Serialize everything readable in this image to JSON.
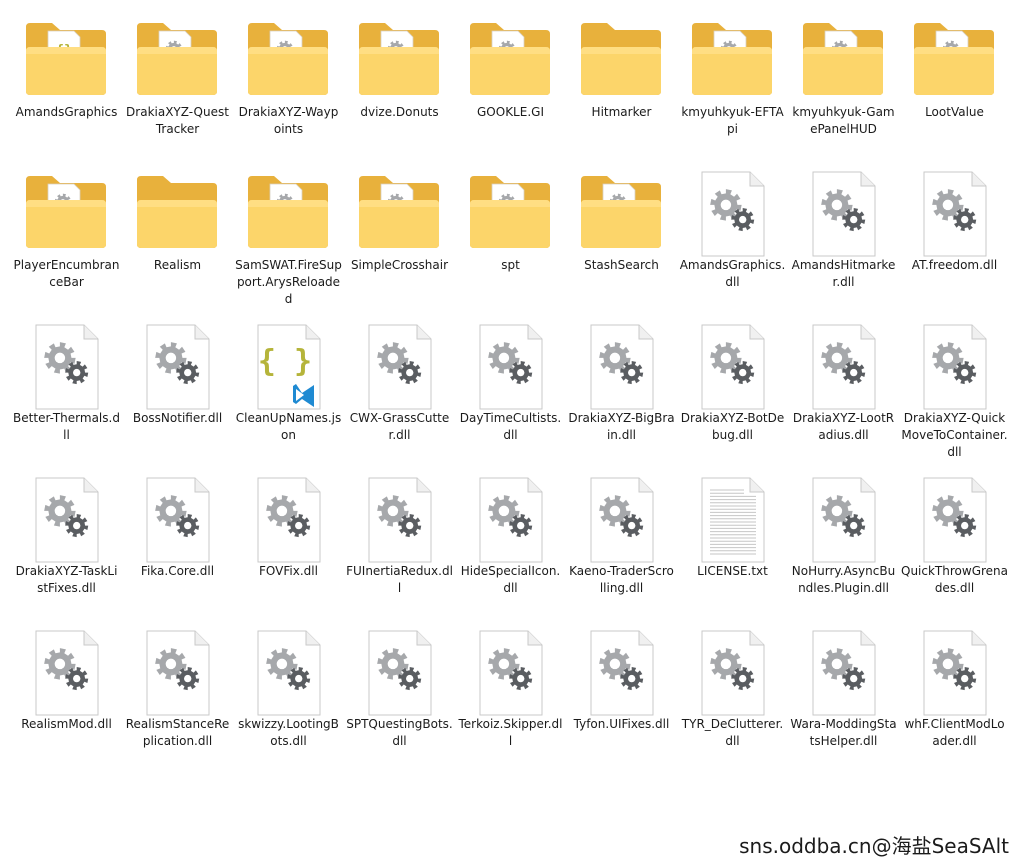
{
  "files": [
    {
      "name": "AmandsGraphics",
      "type": "folder-json"
    },
    {
      "name": "DrakiaXYZ-QuestTracker",
      "type": "folder-dll"
    },
    {
      "name": "DrakiaXYZ-Waypoints",
      "type": "folder-dll"
    },
    {
      "name": "dvize.Donuts",
      "type": "folder-dll"
    },
    {
      "name": "GOOKLE.GI",
      "type": "folder-dll"
    },
    {
      "name": "Hitmarker",
      "type": "folder"
    },
    {
      "name": "kmyuhkyuk-EFTApi",
      "type": "folder-dll"
    },
    {
      "name": "kmyuhkyuk-GamePanelHUD",
      "type": "folder-dll"
    },
    {
      "name": "LootValue",
      "type": "folder-dll"
    },
    {
      "name": "PlayerEncumbranceBar",
      "type": "folder-dll"
    },
    {
      "name": "Realism",
      "type": "folder"
    },
    {
      "name": "SamSWAT.FireSupport.ArysReloaded",
      "type": "folder-dll"
    },
    {
      "name": "SimpleCrosshair",
      "type": "folder-dll"
    },
    {
      "name": "spt",
      "type": "folder-dll"
    },
    {
      "name": "StashSearch",
      "type": "folder-dll"
    },
    {
      "name": "AmandsGraphics.dll",
      "type": "dll"
    },
    {
      "name": "AmandsHitmarker.dll",
      "type": "dll"
    },
    {
      "name": "AT.freedom.dll",
      "type": "dll"
    },
    {
      "name": "Better-Thermals.dll",
      "type": "dll"
    },
    {
      "name": "BossNotifier.dll",
      "type": "dll"
    },
    {
      "name": "CleanUpNames.json",
      "type": "json"
    },
    {
      "name": "CWX-GrassCutter.dll",
      "type": "dll"
    },
    {
      "name": "DayTimeCultists.dll",
      "type": "dll"
    },
    {
      "name": "DrakiaXYZ-BigBrain.dll",
      "type": "dll"
    },
    {
      "name": "DrakiaXYZ-BotDebug.dll",
      "type": "dll"
    },
    {
      "name": "DrakiaXYZ-LootRadius.dll",
      "type": "dll"
    },
    {
      "name": "DrakiaXYZ-QuickMoveToContainer.dll",
      "type": "dll"
    },
    {
      "name": "DrakiaXYZ-TaskListFixes.dll",
      "type": "dll"
    },
    {
      "name": "Fika.Core.dll",
      "type": "dll"
    },
    {
      "name": "FOVFix.dll",
      "type": "dll"
    },
    {
      "name": "FUInertiaRedux.dll",
      "type": "dll"
    },
    {
      "name": "HideSpecialIcon.dll",
      "type": "dll"
    },
    {
      "name": "Kaeno-TraderScrolling.dll",
      "type": "dll"
    },
    {
      "name": "LICENSE.txt",
      "type": "txt"
    },
    {
      "name": "NoHurry.AsyncBundles.Plugin.dll",
      "type": "dll"
    },
    {
      "name": "QuickThrowGrenades.dll",
      "type": "dll"
    },
    {
      "name": "RealismMod.dll",
      "type": "dll"
    },
    {
      "name": "RealismStanceReplication.dll",
      "type": "dll"
    },
    {
      "name": "skwizzy.LootingBots.dll",
      "type": "dll"
    },
    {
      "name": "SPTQuestingBots.dll",
      "type": "dll"
    },
    {
      "name": "Terkoiz.Skipper.dll",
      "type": "dll"
    },
    {
      "name": "Tyfon.UIFixes.dll",
      "type": "dll"
    },
    {
      "name": "TYR_DeClutterer.dll",
      "type": "dll"
    },
    {
      "name": "Wara-ModdingStatsHelper.dll",
      "type": "dll"
    },
    {
      "name": "whF.ClientModLoader.dll",
      "type": "dll"
    }
  ],
  "watermark": "sns.oddba.cn@海盐SeaSAlt",
  "colors": {
    "folder_back": "#e8b13c",
    "folder_front": "#fcd56a",
    "folder_front_light": "#ffe08a",
    "gear_light": "#a6a8ab",
    "gear_dark": "#5a5d61",
    "json_brace": "#b5b43a",
    "vscode_blue": "#1f8ad2"
  }
}
